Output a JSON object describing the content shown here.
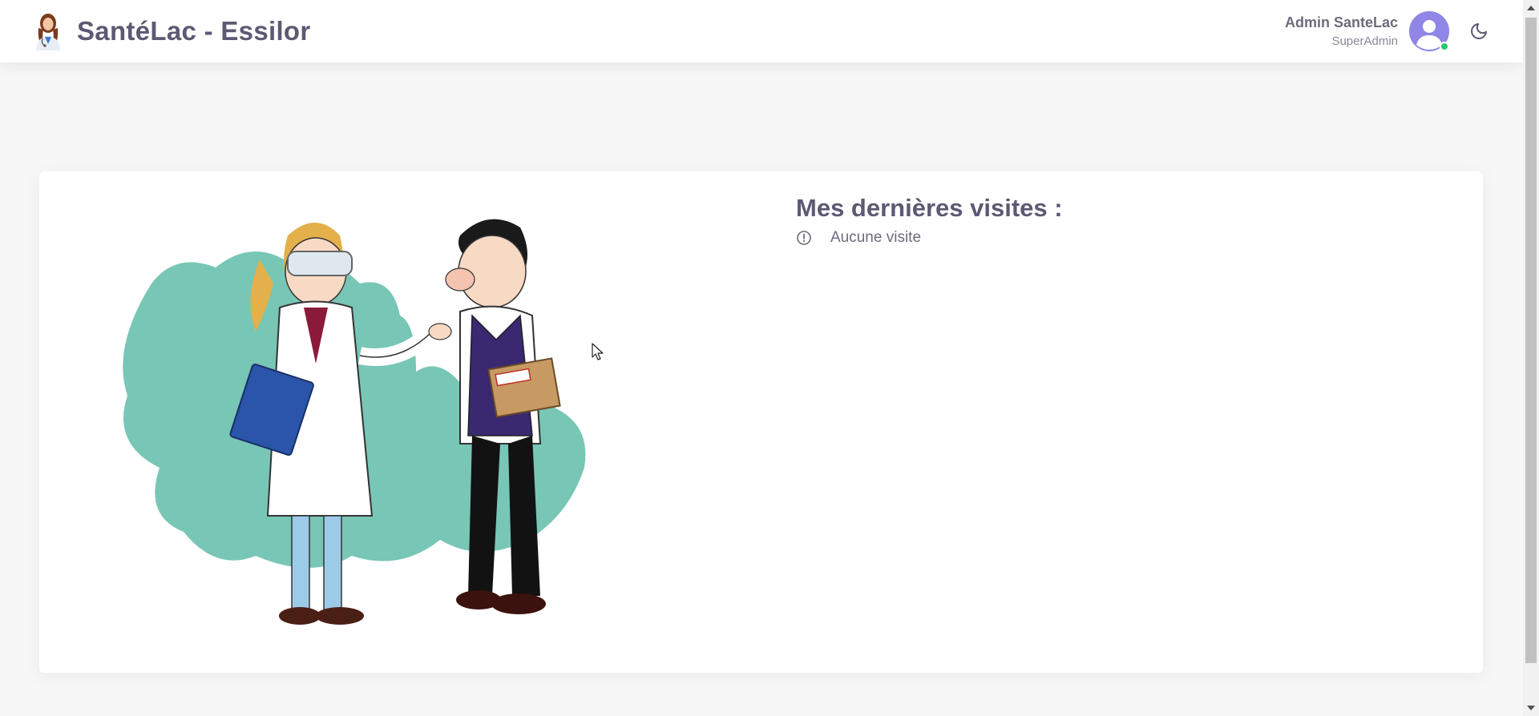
{
  "header": {
    "app_title": "SantéLac - Essilor",
    "logo_icon": "doctor-logo-icon",
    "user": {
      "name": "Admin SanteLac",
      "role": "SuperAdmin",
      "avatar_icon": "user-avatar-icon",
      "status": "online",
      "status_color": "#28c76f",
      "avatar_color": "#8f86e8"
    },
    "theme_toggle_icon": "moon-icon"
  },
  "main": {
    "illustration_icon": "pharmacist-and-sales-rep-illustration",
    "visits": {
      "title": "Mes dernières visites :",
      "empty_icon": "alert-circle-icon",
      "empty_text": "Aucune visite"
    }
  },
  "colors": {
    "accent_teal": "#78c6b6",
    "text_primary": "#5e5873",
    "background": "#f7f7f7"
  }
}
